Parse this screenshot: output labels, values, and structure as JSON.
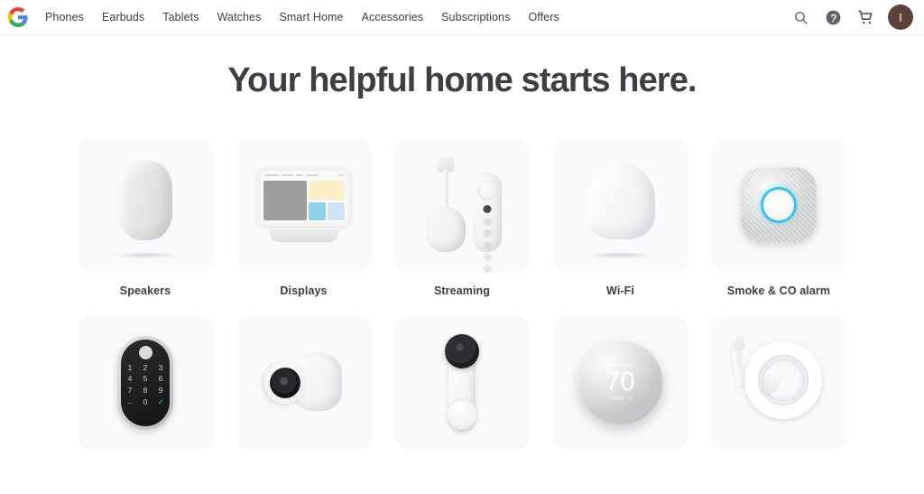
{
  "header": {
    "logo_name": "google-logo",
    "nav": [
      {
        "label": "Phones"
      },
      {
        "label": "Earbuds"
      },
      {
        "label": "Tablets"
      },
      {
        "label": "Watches"
      },
      {
        "label": "Smart Home"
      },
      {
        "label": "Accessories"
      },
      {
        "label": "Subscriptions"
      },
      {
        "label": "Offers"
      }
    ],
    "actions": {
      "search_icon": "search-icon",
      "help_icon": "help-circle-icon",
      "cart_icon": "shopping-cart-icon",
      "avatar_initial": "I",
      "avatar_color": "#5d4037"
    }
  },
  "main": {
    "hero_title": "Your helpful home starts here.",
    "card_background": "#f7f9fa",
    "categories": [
      {
        "label": "Speakers",
        "art": "nest-audio-speaker"
      },
      {
        "label": "Displays",
        "art": "nest-hub-display"
      },
      {
        "label": "Streaming",
        "art": "chromecast-with-remote"
      },
      {
        "label": "Wi-Fi",
        "art": "nest-wifi-router"
      },
      {
        "label": "Smoke & CO alarm",
        "art": "nest-protect-alarm"
      },
      {
        "label": "",
        "art": "nest-yale-smart-lock"
      },
      {
        "label": "",
        "art": "nest-cam"
      },
      {
        "label": "",
        "art": "nest-doorbell"
      },
      {
        "label": "",
        "art": "nest-thermostat"
      },
      {
        "label": "",
        "art": "usb-c-cable"
      }
    ],
    "lock_keys": [
      "1",
      "2",
      "3",
      "4",
      "5",
      "6",
      "7",
      "8",
      "9",
      "←",
      "0",
      "✓"
    ],
    "thermostat": {
      "top_label": "Heat set to",
      "temperature": "70",
      "bottom_label": "Indoor 72"
    }
  }
}
